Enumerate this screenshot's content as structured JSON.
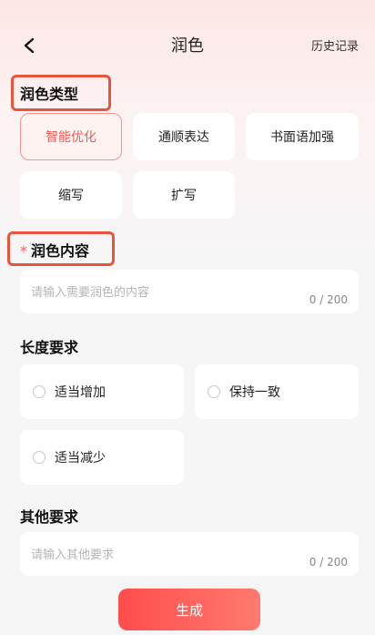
{
  "header": {
    "title": "润色",
    "history_label": "历史记录"
  },
  "type_section": {
    "title": "润色类型",
    "options": [
      "智能优化",
      "通顺表达",
      "书面语加强",
      "缩写",
      "扩写"
    ],
    "selected": "智能优化"
  },
  "content_section": {
    "required_mark": "*",
    "title": "润色内容",
    "placeholder": "请输入需要润色的内容",
    "count": "0 / 200"
  },
  "length_section": {
    "title": "长度要求",
    "options": [
      "适当增加",
      "保持一致",
      "适当减少"
    ]
  },
  "other_section": {
    "title": "其他要求",
    "placeholder": "请输入其他要求",
    "count": "0 / 200"
  },
  "generate_label": "生成",
  "colors": {
    "accent": "#f05a55",
    "highlight_box": "#e8553a"
  }
}
